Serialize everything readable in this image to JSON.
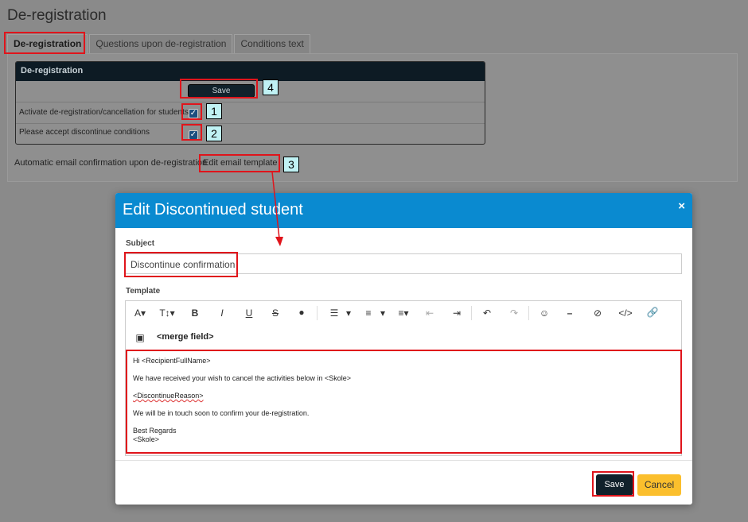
{
  "page": {
    "title": "De-registration"
  },
  "tabs": [
    {
      "label": "De-registration",
      "active": true
    },
    {
      "label": "Questions upon de-registration",
      "active": false
    },
    {
      "label": "Conditions text",
      "active": false
    }
  ],
  "card": {
    "title": "De-registration",
    "save_label": "Save",
    "activate_label": "Activate de-registration/cancellation for students",
    "activate_checked": true,
    "accept_label": "Please accept discontinue conditions",
    "accept_checked": true
  },
  "auto_email": {
    "label": "Automatic email confirmation upon de-registration",
    "link": "Edit email template"
  },
  "callouts": [
    "1",
    "2",
    "3",
    "4"
  ],
  "modal": {
    "title": "Edit Discontinued student",
    "close": "×",
    "subject_label": "Subject",
    "subject_value": "Discontinue confirmation",
    "template_label": "Template",
    "merge_field": "<merge field>",
    "body": {
      "line1": "Hi <RecipientFullName>",
      "line2": "We have received your wish to cancel the activities below in <Skole>",
      "line3": "<DiscontinueReason>",
      "line4": "We will be in touch soon to confirm your de-registration.",
      "line5a": "Best Regards",
      "line5b": "<Skole>"
    },
    "save_label": "Save",
    "cancel_label": "Cancel"
  },
  "colors": {
    "header_blue": "#0a8ad0",
    "dark": "#11212b",
    "cancel_yellow": "#fbbf2d",
    "highlight_red": "#e0141b",
    "callout_cyan": "#c0f2f4"
  },
  "toolbar_icons": [
    "font-family-icon",
    "font-size-icon",
    "bold-icon",
    "italic-icon",
    "underline-icon",
    "strikethrough-icon",
    "color-drop-icon",
    "bullet-list-icon",
    "numbered-list-icon",
    "align-icon",
    "outdent-icon",
    "indent-icon",
    "undo-icon",
    "redo-icon",
    "emoji-icon",
    "horizontal-rule-icon",
    "clear-format-icon",
    "code-view-icon",
    "link-icon",
    "image-icon"
  ]
}
